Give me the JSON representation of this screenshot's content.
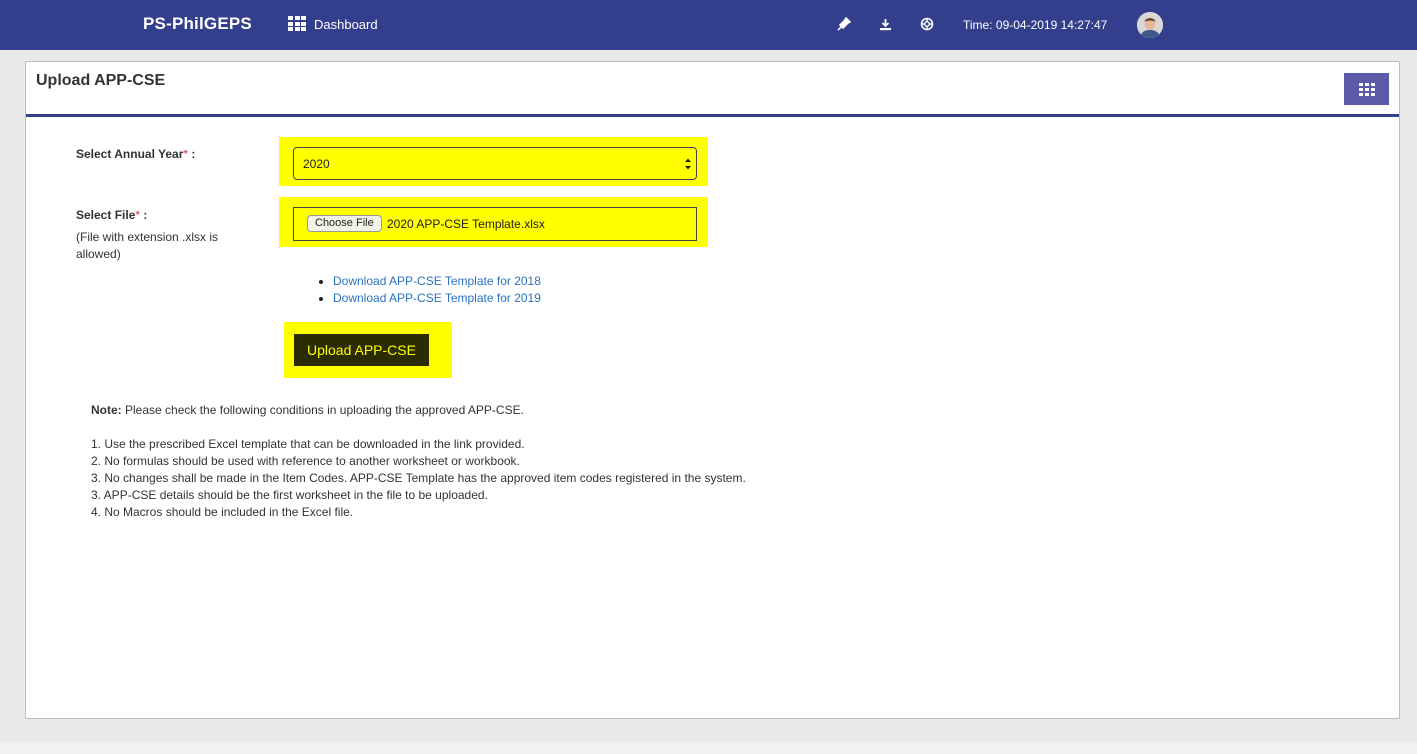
{
  "navbar": {
    "brand": "PS-PhilGEPS",
    "dashboard_label": "Dashboard",
    "icons": [
      "plug-icon",
      "download-icon",
      "support-icon"
    ],
    "time": "Time: 09-04-2019 14:27:47",
    "color": "#333e8c"
  },
  "panel": {
    "title": "Upload APP-CSE"
  },
  "form": {
    "year_label": "Select Annual Year",
    "year_value": "2020",
    "file_label": "Select File",
    "file_hint": "(File with extension .xlsx is allowed)",
    "choose_file": "Choose File",
    "file_name": "2020 APP-CSE Template.xlsx",
    "required_mark": "*",
    "colon": " :"
  },
  "links": [
    "Download APP-CSE Template for 2018",
    "Download APP-CSE Template for 2019"
  ],
  "upload_button": "Upload APP-CSE",
  "note": {
    "prefix": "Note:",
    "text": "Please check the following conditions in uploading the approved APP-CSE.",
    "items": [
      "1. Use the prescribed Excel template that can be downloaded in the link provided.",
      "2. No formulas should be used with reference to another worksheet or workbook.",
      "3. No changes shall be made in the Item Codes. APP-CSE Template has the approved item codes registered in the system.",
      "3. APP-CSE details should be the first worksheet in the file to be uploaded.",
      "4. No Macros should be included in the Excel file."
    ]
  },
  "highlight_color": "#ffff00"
}
